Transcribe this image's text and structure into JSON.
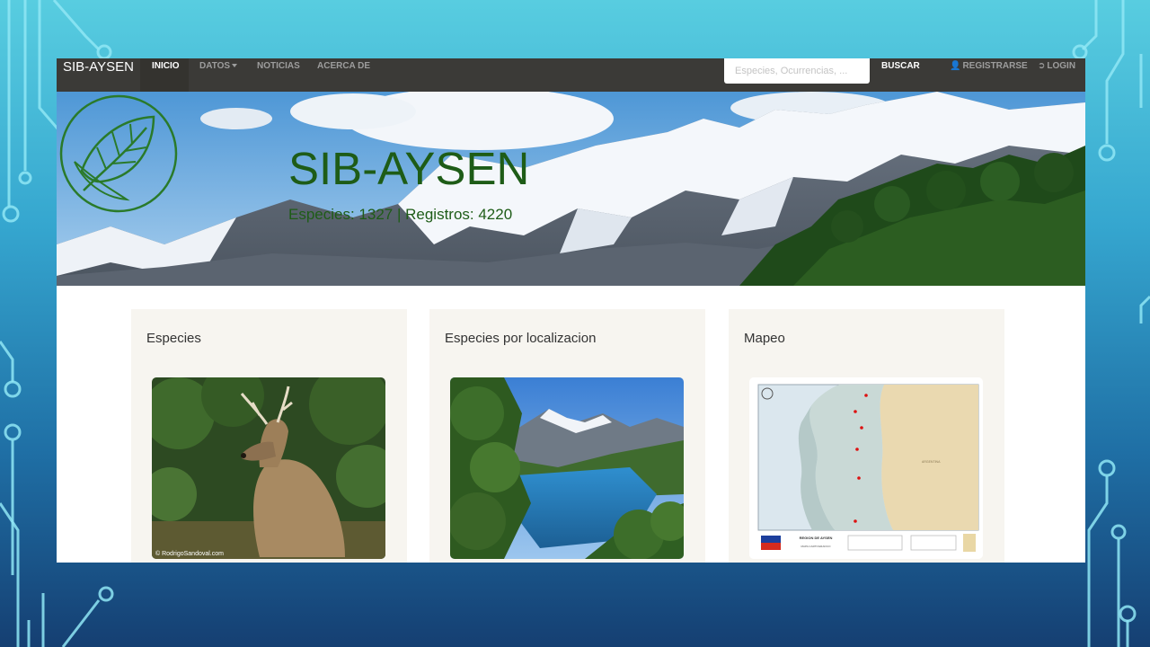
{
  "navbar": {
    "brand": "SIB-AYSEN",
    "items": [
      {
        "label": "INICIO",
        "active": true
      },
      {
        "label": "DATOS",
        "dropdown": true
      },
      {
        "label": "NOTICIAS"
      },
      {
        "label": "ACERCA DE"
      }
    ],
    "search_placeholder": "Especies, Ocurrencias, ...",
    "search_button": "BUSCAR",
    "register_label": "REGISTRARSE",
    "login_label": "LOGIN"
  },
  "hero": {
    "title": "SIB-AYSEN",
    "subtitle": "Especies: 1327 | Registros: 4220"
  },
  "cards": [
    {
      "title": "Especies",
      "image": "deer-photo",
      "credit": "© RodrigoSandoval.com"
    },
    {
      "title": "Especies por localizacion",
      "image": "river-landscape-photo"
    },
    {
      "title": "Mapeo",
      "image": "region-map",
      "map_title": "REGION DE AYSEN",
      "map_subtitle": "MAPA CARTOGRAFICO",
      "map_area_label": "ARGENTINA"
    }
  ],
  "colors": {
    "navbar_bg": "#3b3a37",
    "hero_green": "#1e5c17",
    "card_bg": "#f7f5f0"
  }
}
